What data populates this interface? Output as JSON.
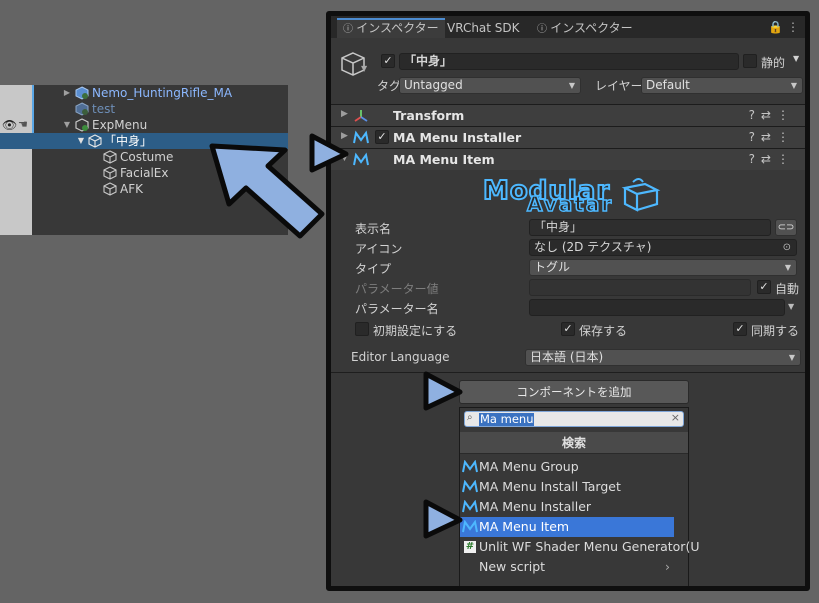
{
  "hierarchy": {
    "items": [
      {
        "label": "Nemo_HuntingRifle_MA",
        "icon": "prefab-icon",
        "fold": "collapsed",
        "color": "#8cb8ff"
      },
      {
        "label": "test",
        "icon": "prefab-icon",
        "fold": "none",
        "color": "#6e8fb8"
      },
      {
        "label": "ExpMenu",
        "icon": "prefab-icon",
        "fold": "expanded",
        "color": "#d2d2d2"
      },
      {
        "label": "「中身」",
        "icon": "gameobject-icon",
        "fold": "expanded",
        "color": "#ffffff"
      },
      {
        "label": "Costume",
        "icon": "gameobject-icon",
        "fold": "none",
        "color": "#d2d2d2"
      },
      {
        "label": "FacialEx",
        "icon": "gameobject-icon",
        "fold": "none",
        "color": "#d2d2d2"
      },
      {
        "label": "AFK",
        "icon": "gameobject-icon",
        "fold": "none",
        "color": "#d2d2d2"
      }
    ]
  },
  "inspector": {
    "tabs": [
      {
        "label": "インスペクター",
        "icon": "info-icon",
        "active": true
      },
      {
        "label": "VRChat SDK",
        "icon": "",
        "active": false
      },
      {
        "label": "インスペクター",
        "icon": "info-icon",
        "active": false
      }
    ],
    "lock_icon": "lock-icon",
    "object": {
      "name": "「中身」",
      "active": true,
      "static_label": "静的",
      "tag_label": "タグ",
      "tag_value": "Untagged",
      "layer_label": "レイヤー",
      "layer_value": "Default"
    },
    "components": [
      {
        "name": "Transform",
        "icon": "transform-icon",
        "has_checkbox": false,
        "checked": false,
        "fold": "collapsed"
      },
      {
        "name": "MA Menu Installer",
        "icon": "ma-icon",
        "has_checkbox": true,
        "checked": true,
        "fold": "collapsed"
      },
      {
        "name": "MA Menu Item",
        "icon": "ma-icon",
        "has_checkbox": false,
        "checked": false,
        "fold": "expanded"
      }
    ],
    "logo": {
      "line1": "Modular",
      "line2": "Avatar"
    },
    "menu_item": {
      "display_name_label": "表示名",
      "display_name_value": "「中身」",
      "icon_label": "アイコン",
      "icon_value": "なし (2D テクスチャ)",
      "type_label": "タイプ",
      "type_value": "トグル",
      "param_value_label": "パラメーター値",
      "auto_label": "自動",
      "auto_checked": true,
      "param_name_label": "パラメーター名",
      "param_name_value": "",
      "default_label": "初期設定にする",
      "default_checked": false,
      "saved_label": "保存する",
      "saved_checked": true,
      "synced_label": "同期する",
      "synced_checked": true,
      "editor_language_label": "Editor Language",
      "editor_language_value": "日本語 (日本)"
    },
    "add_component": {
      "button_label": "コンポーネントを追加",
      "search_value": "Ma menu",
      "section_header": "検索",
      "results": [
        {
          "label": "MA Menu Group",
          "icon": "ma-icon",
          "selected": false
        },
        {
          "label": "MA Menu Install Target",
          "icon": "ma-icon",
          "selected": false
        },
        {
          "label": "MA Menu Installer",
          "icon": "ma-icon",
          "selected": false
        },
        {
          "label": "MA Menu Item",
          "icon": "ma-icon",
          "selected": true
        },
        {
          "label": "Unlit WF Shader Menu Generator(U",
          "icon": "script-icon",
          "selected": false
        },
        {
          "label": "New script",
          "icon": "",
          "selected": false
        }
      ]
    }
  },
  "colors": {
    "accent_selection": "#2c5d87",
    "popup_selection": "#3a77d8",
    "arrow_fill": "#8fb0e0",
    "arrow_outline": "#0a0a0a",
    "ma_icon": "#4db8ff"
  }
}
